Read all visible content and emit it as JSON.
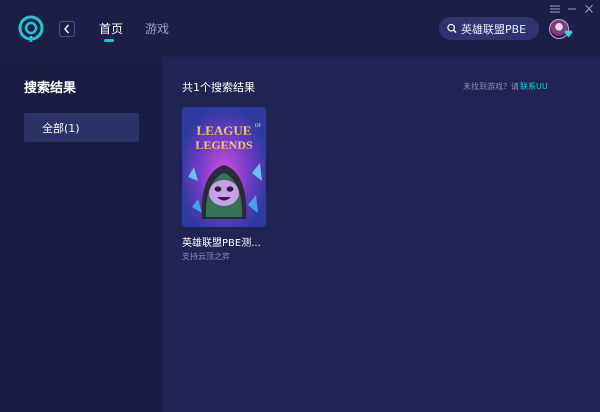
{
  "header": {
    "tabs": [
      {
        "label": "首页",
        "active": true
      },
      {
        "label": "游戏",
        "active": false
      }
    ],
    "search": {
      "value": "英雄联盟PBE",
      "placeholder": ""
    },
    "icons": {
      "logo": "app-logo-icon",
      "back": "chevron-left-icon",
      "search": "search-icon",
      "avatar": "user-avatar",
      "vip": "diamond-icon",
      "menu": "menu-icon",
      "minimize": "minimize-icon",
      "close": "close-icon"
    }
  },
  "sidebar": {
    "title": "搜索结果",
    "items": [
      {
        "label": "全部(1)",
        "active": true
      }
    ]
  },
  "main": {
    "result_count": "共1个搜索结果",
    "not_found_text": "未找到游戏？请",
    "contact_link": "联系UU",
    "games": [
      {
        "name": "英雄联盟PBE测...",
        "subtitle": "支持云顶之弈",
        "cover_text_top": "LEAGUE",
        "cover_text_of": "OF",
        "cover_text_bottom": "LEGENDS"
      }
    ]
  },
  "colors": {
    "accent": "#18c6cf",
    "background": "#1c1f45",
    "sidebar": "#1a1d42",
    "main": "#212452",
    "sidebar_active": "#2c3166",
    "search_bg": "#2f3370"
  }
}
